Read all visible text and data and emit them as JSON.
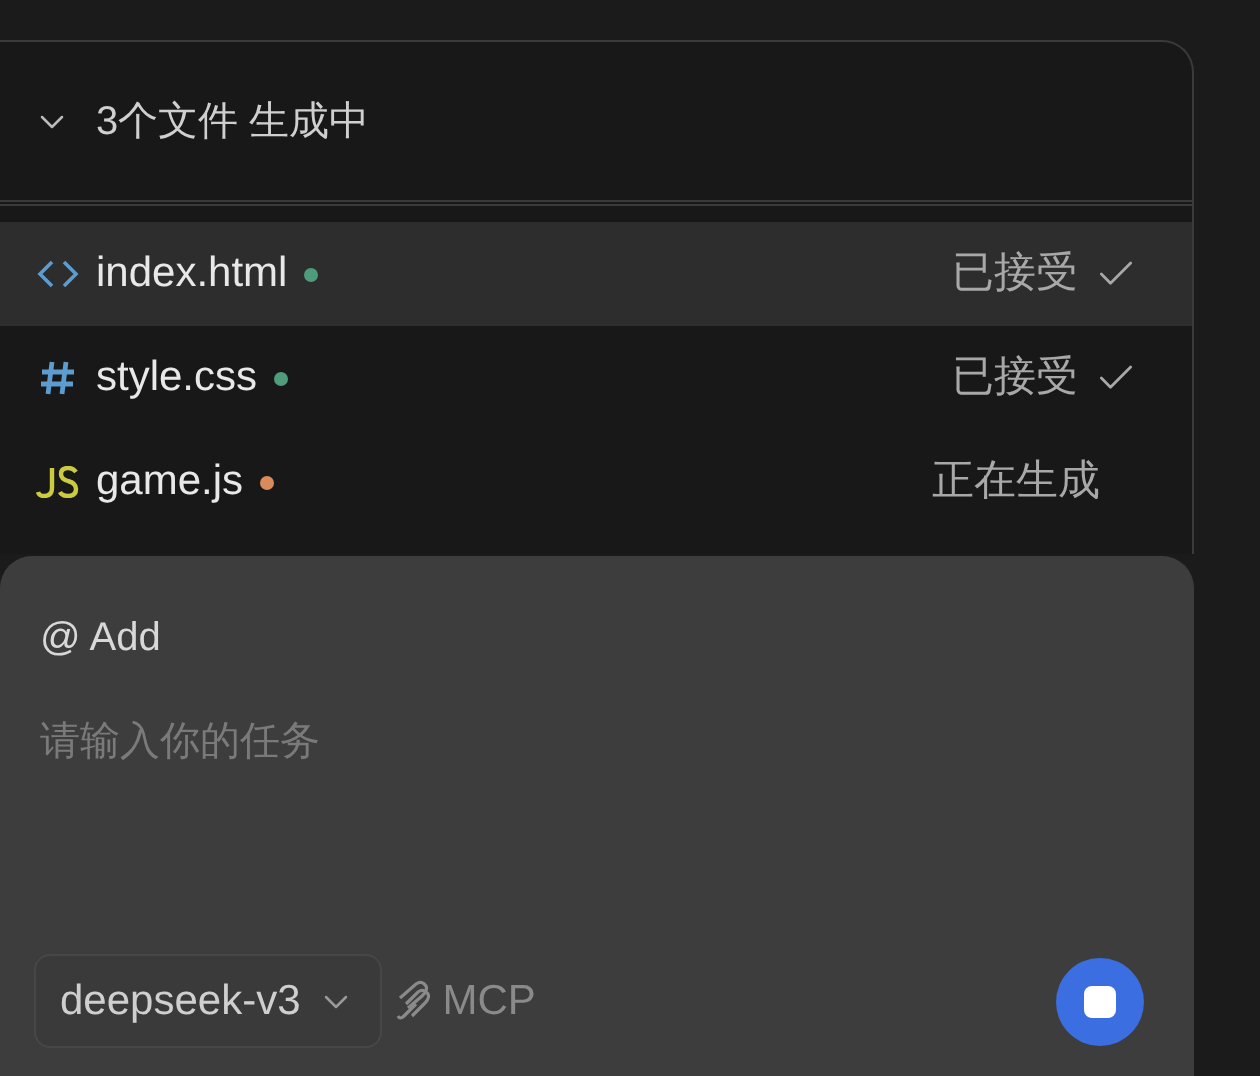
{
  "header": {
    "expanded": true,
    "title": "3个文件 生成中"
  },
  "files": [
    {
      "kind": "html",
      "name": "index.html",
      "color": "#4e9c7c",
      "status": "已接受",
      "accepted": true,
      "selected": true
    },
    {
      "kind": "css",
      "name": "style.css",
      "color": "#4e9c7c",
      "status": "已接受",
      "accepted": true,
      "selected": false
    },
    {
      "kind": "js",
      "name": "game.js",
      "color": "#d98b5a",
      "status": "正在生成",
      "accepted": false,
      "selected": false
    }
  ],
  "composer": {
    "mention": "@ Add",
    "placeholder": "请输入你的任务",
    "model": "deepseek-v3",
    "tool": "MCP",
    "generating": true
  }
}
